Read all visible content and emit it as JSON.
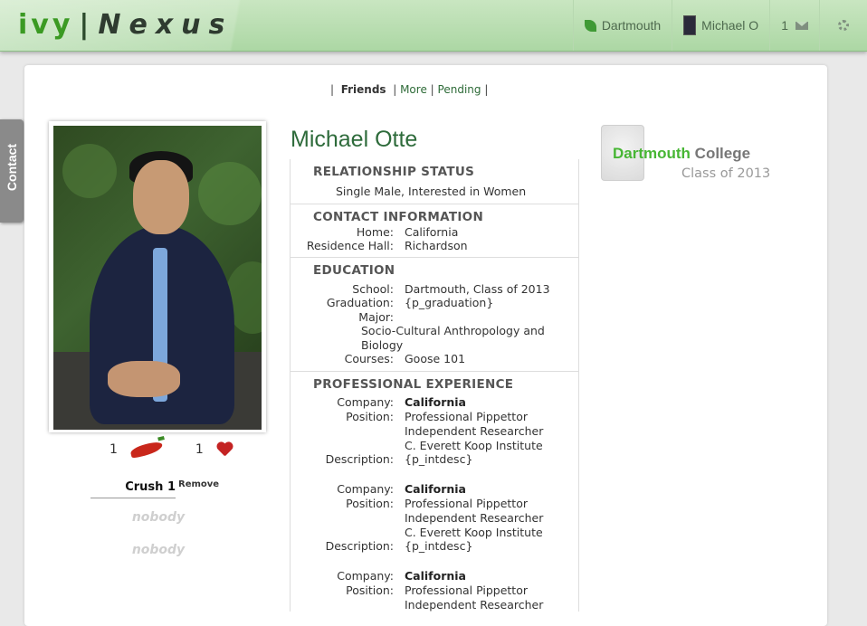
{
  "header": {
    "logo_ivy": "ivy",
    "logo_sep": "|",
    "logo_nexus": "Nexus",
    "school": "Dartmouth",
    "user": "Michael O",
    "messages_count": "1"
  },
  "sidebar_tab": {
    "label": "Contact"
  },
  "tabs": {
    "sep": "|",
    "friends": "Friends",
    "more": "More",
    "pending": "Pending"
  },
  "votes": {
    "chili_count": "1",
    "heart_count": "1"
  },
  "crush": {
    "label": "Crush 1",
    "remove": "Remove",
    "slots": [
      "nobody",
      "nobody"
    ]
  },
  "profile": {
    "name": "Michael Otte",
    "relationship": {
      "title": "RELATIONSHIP STATUS",
      "value": "Single Male, Interested in Women"
    },
    "contact": {
      "title": "CONTACT INFORMATION",
      "home_label": "Home:",
      "home": "California",
      "hall_label": "Residence Hall:",
      "hall": "Richardson"
    },
    "education": {
      "title": "EDUCATION",
      "school_label": "School:",
      "school": "Dartmouth, Class of 2013",
      "grad_label": "Graduation:",
      "grad": "{p_graduation}",
      "major_label": "Major:",
      "major_line1": "Socio-Cultural Anthropology and",
      "major_line2": "Biology",
      "courses_label": "Courses:",
      "courses": "Goose 101"
    },
    "professional": {
      "title": "PROFESSIONAL EXPERIENCE",
      "company_label": "Company:",
      "position_label": "Position:",
      "description_label": "Description:",
      "entries": [
        {
          "company": "California",
          "pos1": "Professional Pippettor",
          "pos2": "Independent Researcher",
          "pos3": "C. Everett Koop Institute",
          "desc": "{p_intdesc}"
        },
        {
          "company": "California",
          "pos1": "Professional Pippettor",
          "pos2": "Independent Researcher",
          "pos3": "C. Everett Koop Institute",
          "desc": "{p_intdesc}"
        },
        {
          "company": "California",
          "pos1": "Professional Pippettor",
          "pos2": "Independent Researcher"
        }
      ]
    }
  },
  "school_box": {
    "name_part1": "Dartmouth",
    "name_part2": " College",
    "class": "Class of 2013"
  },
  "colors": {
    "brand_green": "#3b9a23",
    "header_bg": "#b9dfb1",
    "name_green": "#2e6b3b"
  }
}
